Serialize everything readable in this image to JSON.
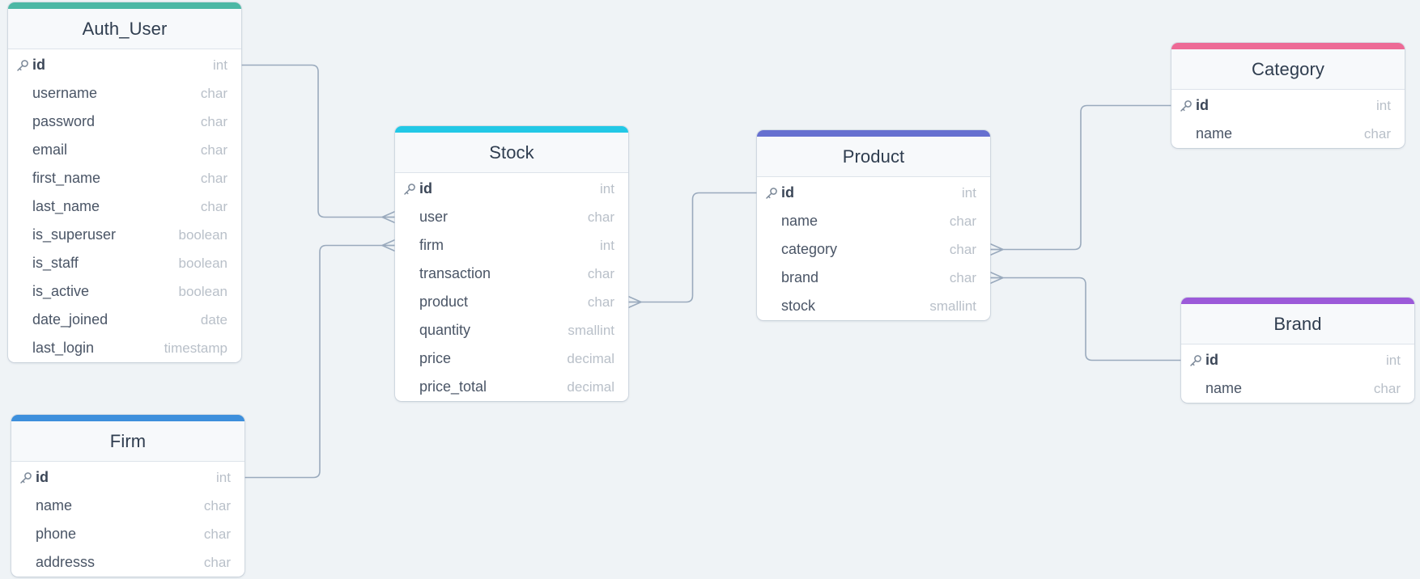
{
  "diagram": {
    "tables": [
      {
        "id": "auth_user",
        "title": "Auth_User",
        "accent": "#4cb8a5",
        "fields": [
          {
            "name": "id",
            "type": "int",
            "pk": true
          },
          {
            "name": "username",
            "type": "char"
          },
          {
            "name": "password",
            "type": "char"
          },
          {
            "name": "email",
            "type": "char"
          },
          {
            "name": "first_name",
            "type": "char"
          },
          {
            "name": "last_name",
            "type": "char"
          },
          {
            "name": "is_superuser",
            "type": "boolean"
          },
          {
            "name": "is_staff",
            "type": "boolean"
          },
          {
            "name": "is_active",
            "type": "boolean"
          },
          {
            "name": "date_joined",
            "type": "date"
          },
          {
            "name": "last_login",
            "type": "timestamp"
          }
        ]
      },
      {
        "id": "firm",
        "title": "Firm",
        "accent": "#3d8fdc",
        "fields": [
          {
            "name": "id",
            "type": "int",
            "pk": true
          },
          {
            "name": "name",
            "type": "char"
          },
          {
            "name": "phone",
            "type": "char"
          },
          {
            "name": "addresss",
            "type": "char"
          }
        ]
      },
      {
        "id": "stock",
        "title": "Stock",
        "accent": "#22c8e6",
        "fields": [
          {
            "name": "id",
            "type": "int",
            "pk": true
          },
          {
            "name": "user",
            "type": "char"
          },
          {
            "name": "firm",
            "type": "int"
          },
          {
            "name": "transaction",
            "type": "char"
          },
          {
            "name": "product",
            "type": "char"
          },
          {
            "name": "quantity",
            "type": "smallint"
          },
          {
            "name": "price",
            "type": "decimal"
          },
          {
            "name": "price_total",
            "type": "decimal"
          }
        ]
      },
      {
        "id": "product",
        "title": "Product",
        "accent": "#6670d0",
        "fields": [
          {
            "name": "id",
            "type": "int",
            "pk": true
          },
          {
            "name": "name",
            "type": "char"
          },
          {
            "name": "category",
            "type": "char"
          },
          {
            "name": "brand",
            "type": "char"
          },
          {
            "name": "stock",
            "type": "smallint"
          }
        ]
      },
      {
        "id": "category",
        "title": "Category",
        "accent": "#ed6a96",
        "fields": [
          {
            "name": "id",
            "type": "int",
            "pk": true
          },
          {
            "name": "name",
            "type": "char"
          }
        ]
      },
      {
        "id": "brand",
        "title": "Brand",
        "accent": "#9c5ad9",
        "fields": [
          {
            "name": "id",
            "type": "int",
            "pk": true
          },
          {
            "name": "name",
            "type": "char"
          }
        ]
      }
    ],
    "relations": [
      {
        "from": "auth_user.id",
        "to": "stock.user",
        "cardinality": "one-to-many"
      },
      {
        "from": "firm.id",
        "to": "stock.firm",
        "cardinality": "one-to-many"
      },
      {
        "from": "product.id",
        "to": "stock.product",
        "cardinality": "one-to-many"
      },
      {
        "from": "category.id",
        "to": "product.category",
        "cardinality": "one-to-many"
      },
      {
        "from": "brand.id",
        "to": "product.brand",
        "cardinality": "one-to-many"
      }
    ],
    "colors": {
      "background": "#eff3f6",
      "connector": "#9aaabd"
    },
    "icons": {
      "primary_key": "key-icon"
    }
  }
}
